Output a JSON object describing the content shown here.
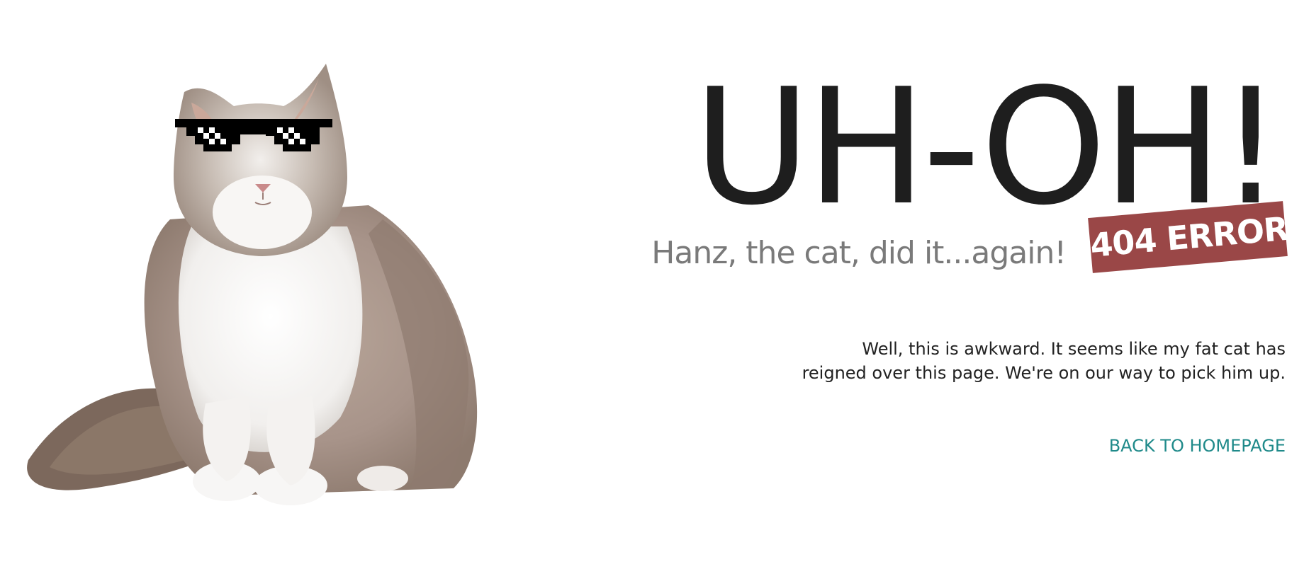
{
  "hero": {
    "headline": "UH-OH!",
    "tagline": "Hanz, the cat, did it...again!",
    "badge": "404 ERROR",
    "message_line1": "Well, this is awkward. It seems like my fat cat has",
    "message_line2": "reigned over this page. We're on our way to pick him up.",
    "link_label": "BACK TO HOMEPAGE"
  },
  "colors": {
    "headline": "#1e1e1e",
    "tagline": "#7a7a7a",
    "badge_bg": "#9a4747",
    "link": "#1f8a8a"
  },
  "illustration": {
    "subject": "cat-with-pixel-sunglasses"
  }
}
